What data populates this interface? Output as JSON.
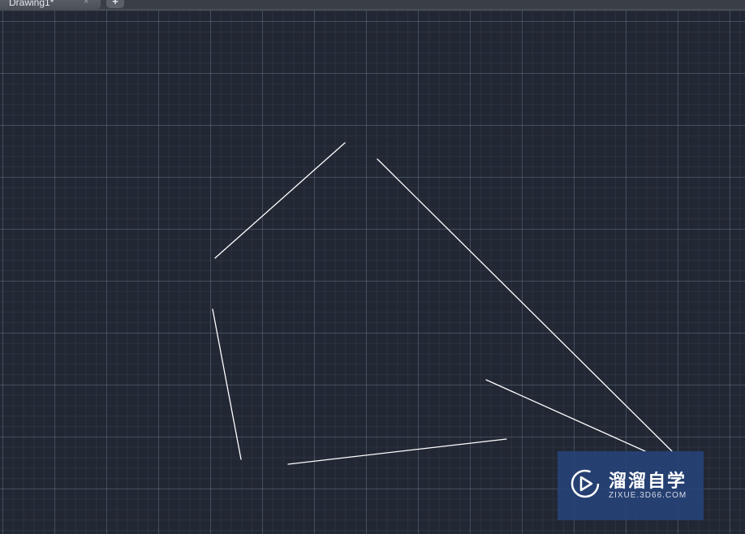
{
  "tabs": {
    "active_title": "Drawing1*",
    "close_symbol": "×",
    "new_tab_symbol": "+"
  },
  "canvas": {
    "background_color": "#212733",
    "line_color": "#ffffff"
  },
  "watermark": {
    "icon": "play-logo-icon",
    "brand_cn": "溜溜自学",
    "brand_url": "ZIXUE.3D66.COM"
  }
}
